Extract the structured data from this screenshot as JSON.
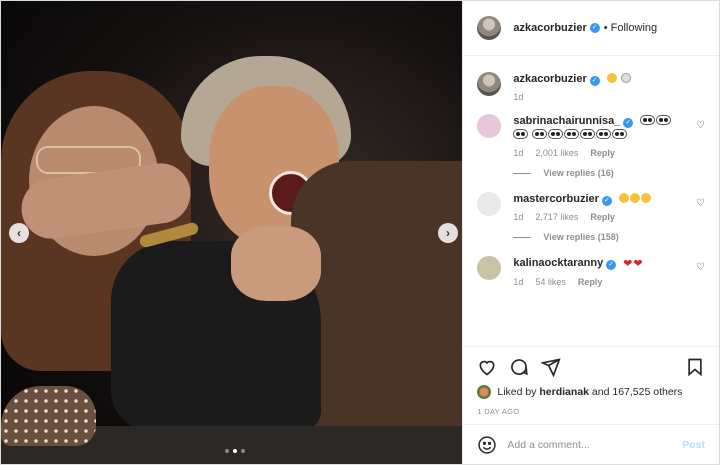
{
  "header": {
    "username": "azkacorbuzier",
    "following": "Following"
  },
  "caption": {
    "username": "azkacorbuzier",
    "emojis": [
      "cold-face",
      "skull"
    ],
    "time": "1d"
  },
  "comments": [
    {
      "username": "sabrinachairunnisa_",
      "emojis": [
        "eyes",
        "eyes",
        "eyes",
        "eyes",
        "eyes",
        "eyes",
        "eyes",
        "eyes",
        "eyes"
      ],
      "time": "1d",
      "likes": "2,001 likes",
      "reply": "Reply",
      "view_replies": "View replies (16)",
      "avatar_color": "#e8c5d8"
    },
    {
      "username": "mastercorbuzier",
      "emojis": [
        "astonished",
        "astonished",
        "scream"
      ],
      "time": "1d",
      "likes": "2,717 likes",
      "reply": "Reply",
      "view_replies": "View replies (158)",
      "avatar_color": "#e9e9e9"
    },
    {
      "username": "kalinaocktaranny",
      "emojis": [
        "heart",
        "heart"
      ],
      "time": "1d",
      "likes": "54 likes",
      "reply": "Reply",
      "avatar_color": "#c9c2a9"
    }
  ],
  "likes": {
    "prefix": "Liked by",
    "user": "herdianak",
    "suffix": "and 167,525 others"
  },
  "timestamp": "1 DAY AGO",
  "add_comment": {
    "placeholder": "Add a comment...",
    "post": "Post"
  },
  "icons": [
    "heart-icon",
    "comment-icon",
    "share-icon",
    "bookmark-icon",
    "emoji-icon",
    "chevron-left-icon",
    "chevron-right-icon"
  ],
  "carousel": {
    "slides": 3,
    "active": 1
  }
}
